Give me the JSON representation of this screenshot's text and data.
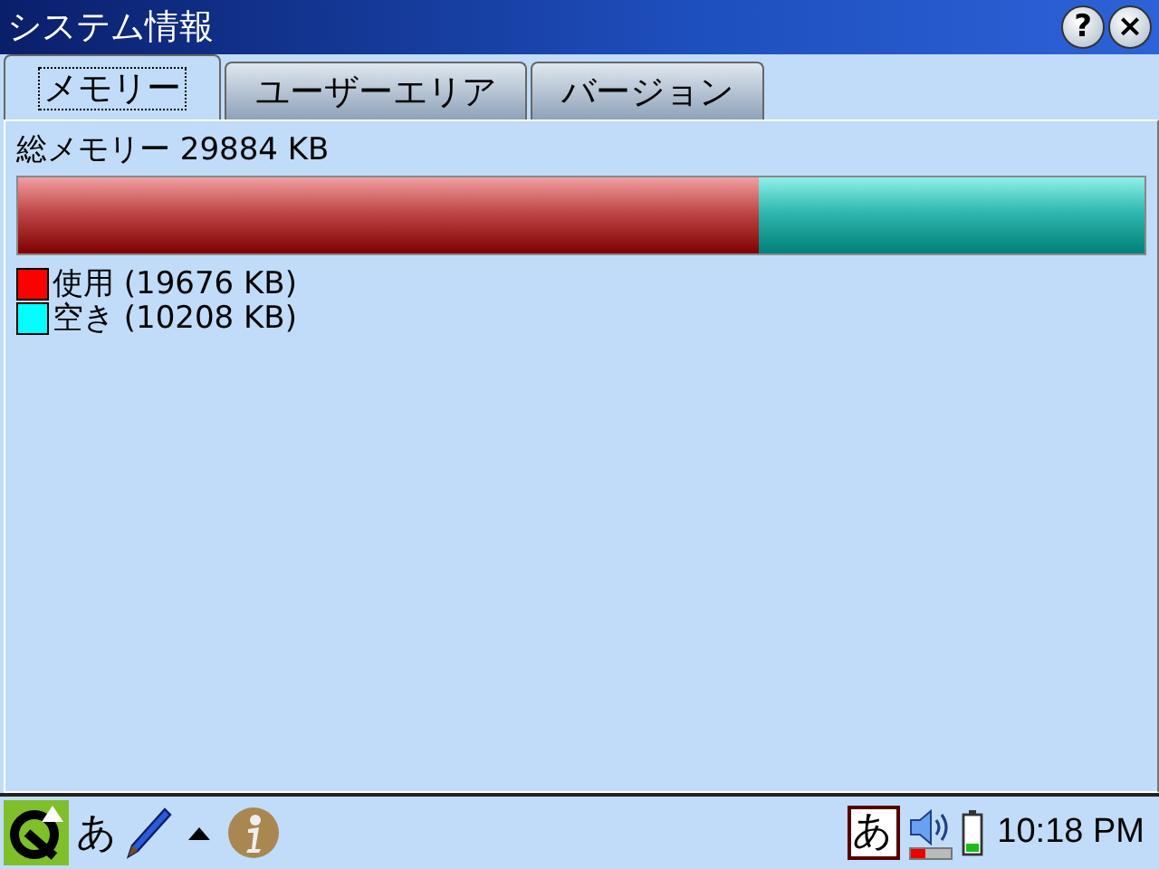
{
  "window": {
    "title": "システム情報",
    "help": "?",
    "close": "×"
  },
  "tabs": [
    {
      "label": "メモリー",
      "selected": true
    },
    {
      "label": "ユーザーエリア",
      "selected": false
    },
    {
      "label": "バージョン",
      "selected": false
    }
  ],
  "memory": {
    "total": "総メモリー 29884 KB",
    "level": 0.658,
    "legend": [
      {
        "label": "使用 (19676 KB)",
        "color": "#ff0000"
      },
      {
        "label": "空き (10208 KB)",
        "color": "#00ffff"
      }
    ]
  },
  "taskbar": {
    "input_mode": "あ",
    "ime": "あ",
    "volume": {
      "level": 0.4
    },
    "clock": "10:18 PM"
  }
}
